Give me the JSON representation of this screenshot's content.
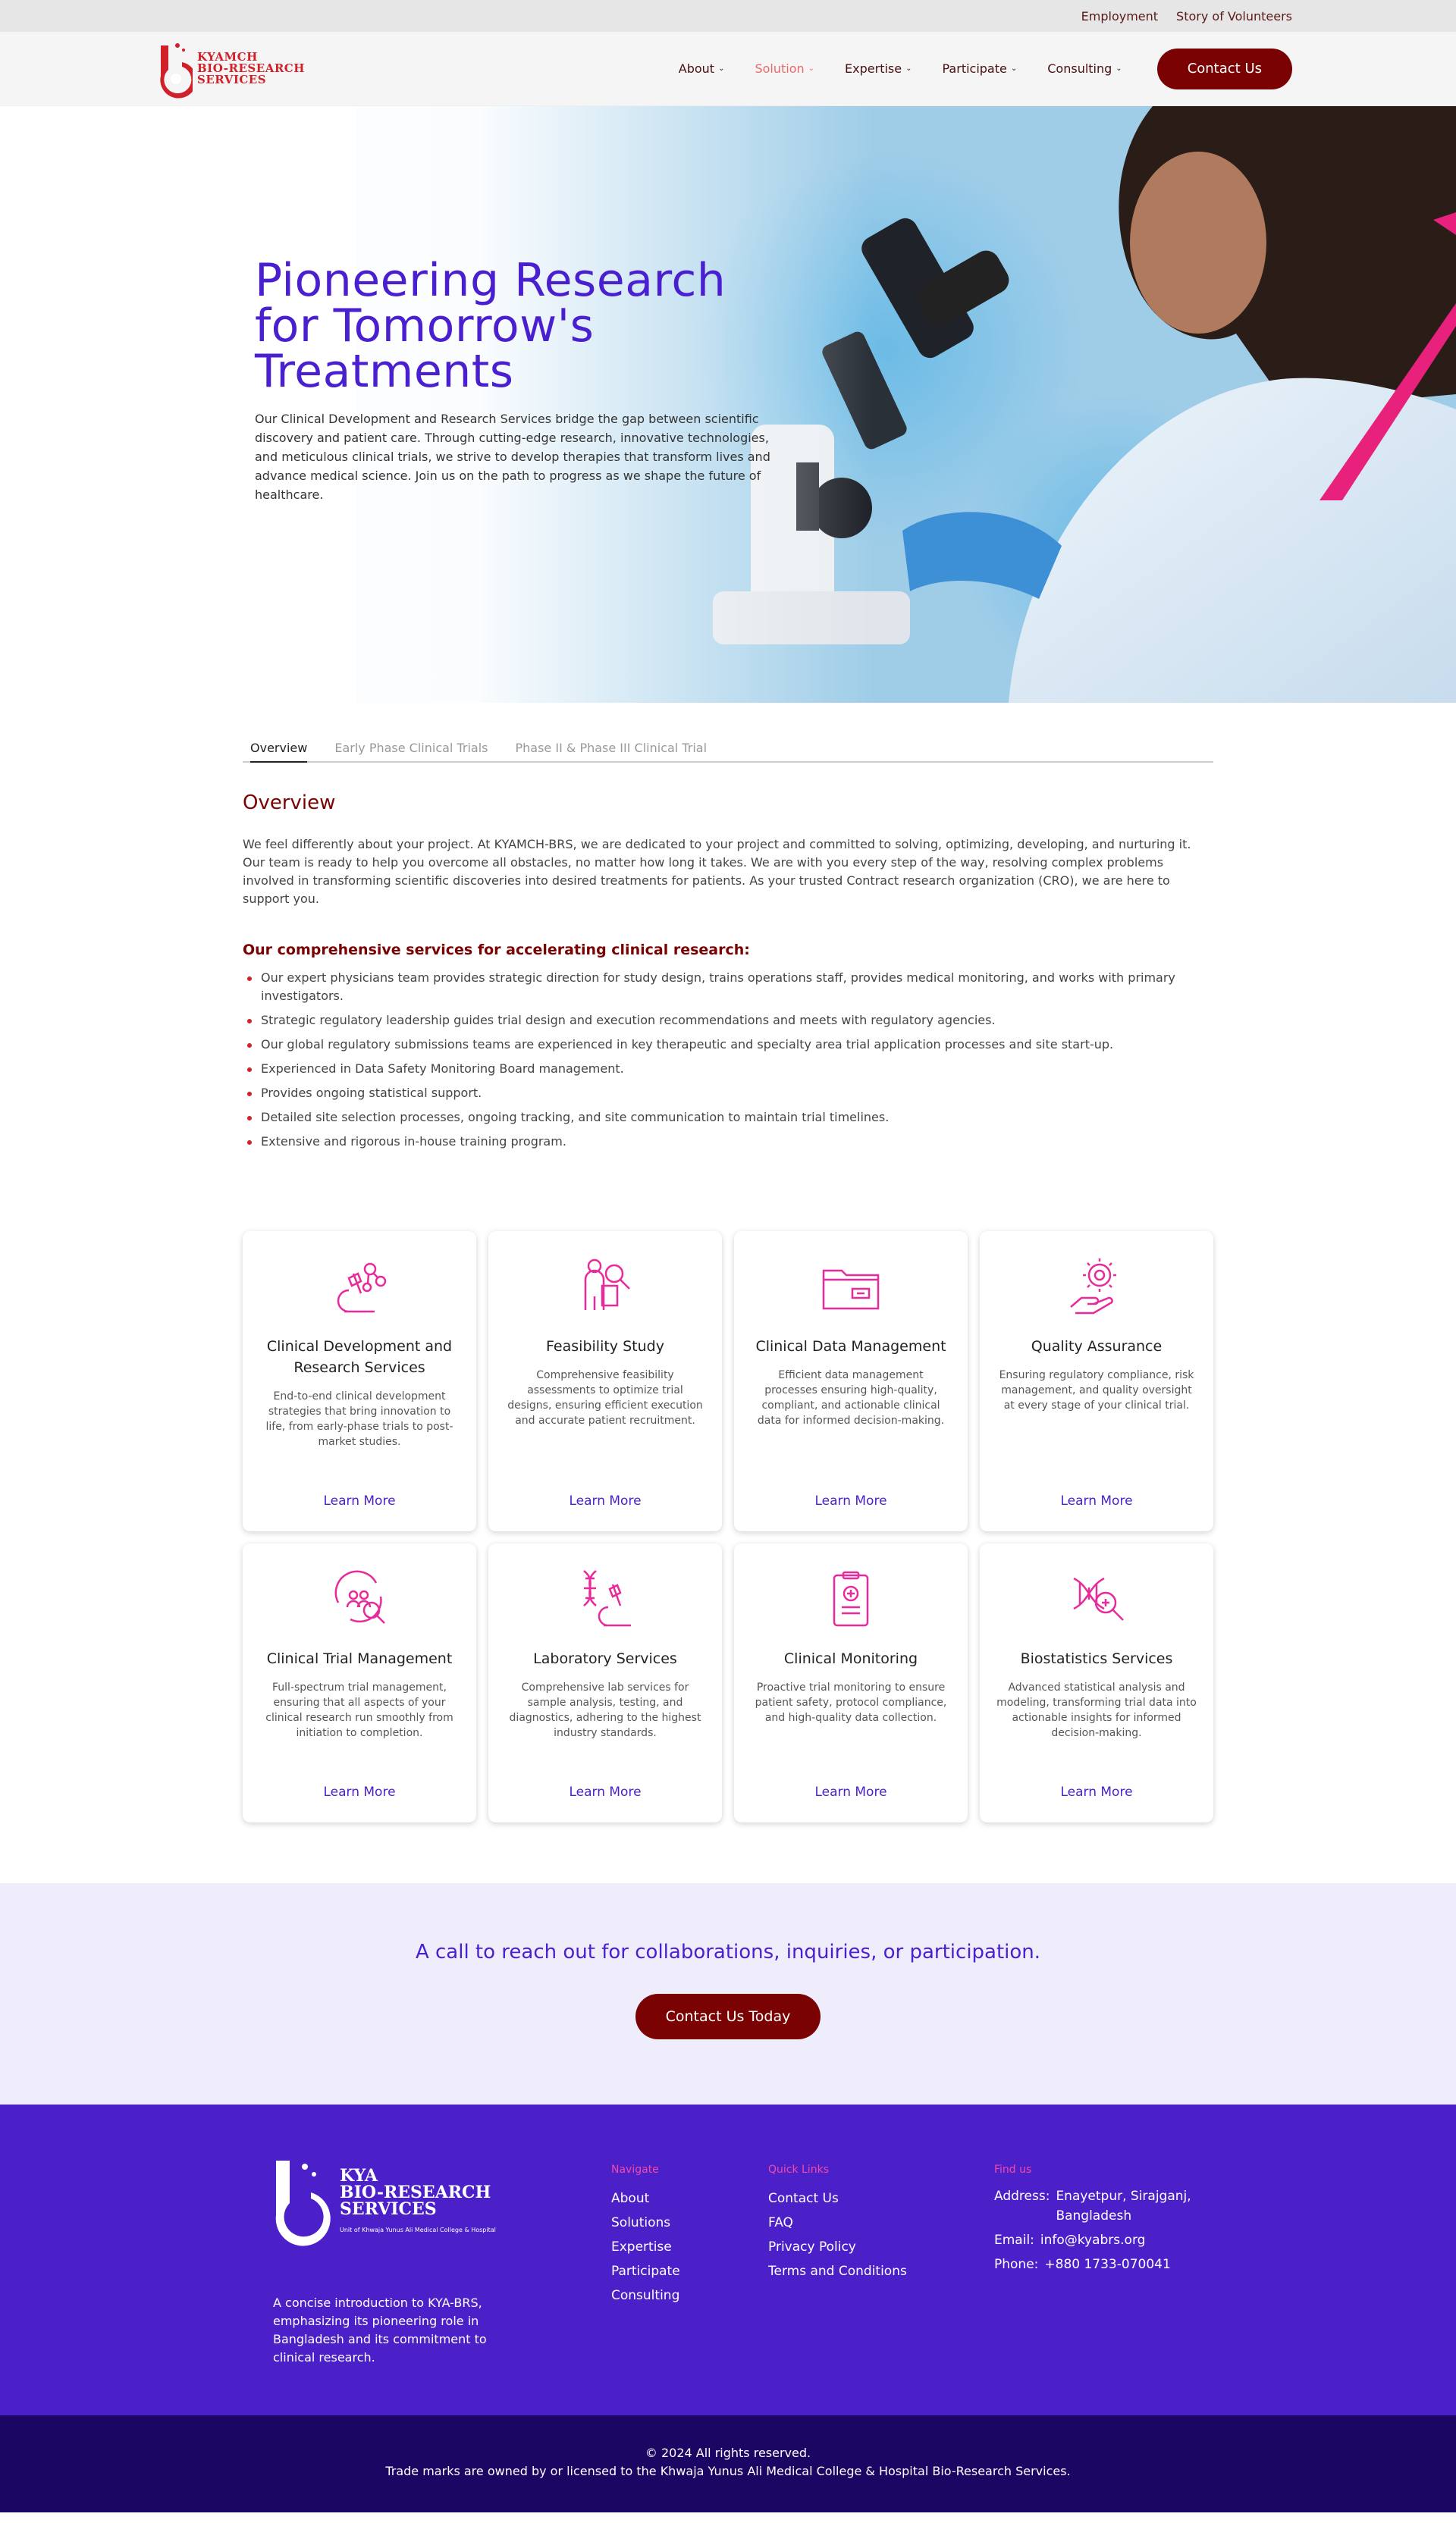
{
  "topbar": {
    "employment": "Employment",
    "volunteers": "Story of Volunteers"
  },
  "logo": {
    "line1": "KYAMCH",
    "line2": "BIO-RESEARCH",
    "line3": "SERVICES"
  },
  "nav": {
    "items": [
      {
        "label": "About",
        "active": false
      },
      {
        "label": "Solution",
        "active": true
      },
      {
        "label": "Expertise",
        "active": false
      },
      {
        "label": "Participate",
        "active": false
      },
      {
        "label": "Consulting",
        "active": false
      }
    ],
    "contact": "Contact Us"
  },
  "hero": {
    "title_line1": "Pioneering Research",
    "title_line2": "for Tomorrow's",
    "title_line3": "Treatments",
    "text": "Our Clinical Development and Research Services bridge the gap between scientific discovery and patient care. Through cutting-edge research, innovative technologies, and meticulous clinical trials, we strive to develop therapies that transform lives and advance medical science. Join us on the path to progress as we shape the future of healthcare."
  },
  "tabs": [
    "Overview",
    "Early Phase Clinical Trials",
    "Phase II & Phase III Clinical Trial"
  ],
  "overview": {
    "title": "Overview",
    "text": "We feel differently about your project. At KYAMCH-BRS, we are dedicated to your project and committed to solving, optimizing, developing, and nurturing it. Our team is ready to help you overcome all obstacles, no matter how long it takes. We are with you every step of the way, resolving complex problems involved in transforming scientific discoveries into desired treatments for patients. As your trusted Contract research organization (CRO), we are here to support you.",
    "services_title": "Our comprehensive services for accelerating clinical research:",
    "bullets": [
      "Our expert physicians team provides strategic direction for study design, trains operations staff, provides medical monitoring, and works with primary investigators.",
      "Strategic regulatory leadership guides trial design and execution recommendations and meets with regulatory agencies.",
      "Our global regulatory submissions teams are experienced in key therapeutic and specialty area trial application processes and site start-up.",
      "Experienced in Data Safety Monitoring Board management.",
      "Provides ongoing statistical support.",
      "Detailed site selection processes, ongoing tracking, and site communication to maintain trial timelines.",
      "Extensive and rigorous in-house training program."
    ]
  },
  "cards": [
    {
      "icon": "microscope-molecule-icon",
      "title": "Clinical Development and Research Services",
      "desc": "End-to-end clinical development strategies that bring innovation to life, from early-phase trials to post-market studies.",
      "link": "Learn More"
    },
    {
      "icon": "person-magnifier-icon",
      "title": "Feasibility Study",
      "desc": "Comprehensive feasibility assessments to optimize trial designs, ensuring efficient execution and accurate patient recruitment.",
      "link": "Learn More"
    },
    {
      "icon": "data-folder-icon",
      "title": "Clinical Data Management",
      "desc": "Efficient data management processes ensuring high-quality, compliant, and actionable clinical data for informed decision-making.",
      "link": "Learn More"
    },
    {
      "icon": "gear-hand-icon",
      "title": "Quality Assurance",
      "desc": "Ensuring regulatory compliance, risk management, and quality oversight at every stage of your clinical trial.",
      "link": "Learn More"
    },
    {
      "icon": "team-search-icon",
      "title": "Clinical Trial Management",
      "desc": "Full-spectrum trial management, ensuring that all aspects of your clinical research run smoothly from initiation to completion.",
      "link": "Learn More"
    },
    {
      "icon": "dna-microscope-icon",
      "title": "Laboratory Services",
      "desc": "Comprehensive lab services for sample analysis, testing, and diagnostics, adhering to the highest industry standards.",
      "link": "Learn More"
    },
    {
      "icon": "clipboard-medical-icon",
      "title": "Clinical Monitoring",
      "desc": "Proactive trial monitoring to ensure patient safety, protocol compliance, and high-quality data collection.",
      "link": "Learn More"
    },
    {
      "icon": "dna-magnifier-icon",
      "title": "Biostatistics Services",
      "desc": "Advanced statistical analysis and modeling, transforming trial data into actionable insights for informed decision-making.",
      "link": "Learn More"
    }
  ],
  "cta": {
    "text": "A call to reach out for collaborations, inquiries, or participation.",
    "button": "Contact Us Today"
  },
  "footer": {
    "logo_line1": "KYA",
    "logo_line2": "BIO-RESEARCH",
    "logo_line3": "SERVICES",
    "logo_sub": "Unit of Khwaja Yunus Ali Medical College & Hospital",
    "about": "A concise introduction to KYA-BRS, emphasizing its pioneering role in Bangladesh and its commitment to clinical research.",
    "navigate_title": "Navigate",
    "navigate": [
      "About",
      "Solutions",
      "Expertise",
      "Participate",
      "Consulting"
    ],
    "quick_title": "Quick Links",
    "quick": [
      "Contact Us",
      "FAQ",
      "Privacy Policy",
      "Terms and Conditions"
    ],
    "find_title": "Find us",
    "address_label": "Address:",
    "address": "Enayetpur, Sirajganj, Bangladesh",
    "email_label": "Email:",
    "email": "info@kyabrs.org",
    "phone_label": "Phone:",
    "phone": "+880 1733-070041",
    "copyright": "© 2024  All rights reserved.",
    "trademark": "Trade marks are owned by or licensed to the Khwaja Yunus Ali Medical College & Hospital Bio-Research Services."
  },
  "colors": {
    "brand_red": "#7a0202",
    "accent_purple": "#4a1fcf",
    "pink": "#e82a9a",
    "footer_bg": "#4c20c8",
    "bottom_bg": "#1b0663"
  }
}
